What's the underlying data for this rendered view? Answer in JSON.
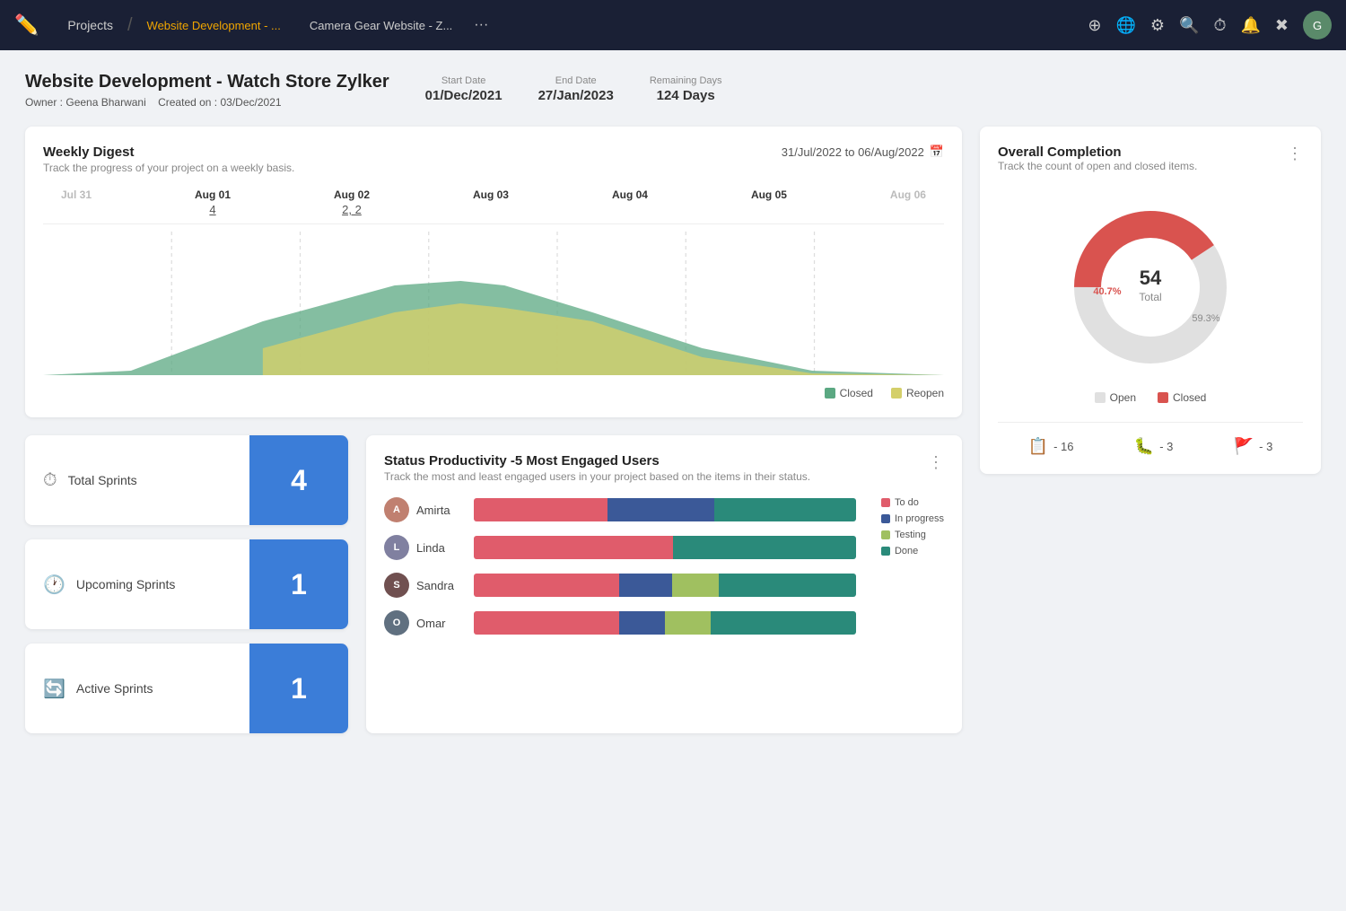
{
  "nav": {
    "logo": "✏",
    "projects_label": "Projects",
    "tab_active": "Website Development - ...",
    "tab_secondary": "Camera Gear Website - Z...",
    "dots": "···"
  },
  "project": {
    "title": "Website Development - Watch Store Zylker",
    "owner_label": "Owner :",
    "owner": "Geena Bharwani",
    "created_label": "Created on :",
    "created": "03/Dec/2021",
    "start_date_label": "Start Date",
    "start_date": "01/Dec/2021",
    "end_date_label": "End Date",
    "end_date": "27/Jan/2023",
    "remaining_label": "Remaining Days",
    "remaining": "124 Days"
  },
  "weekly_digest": {
    "title": "Weekly Digest",
    "subtitle": "Track the progress of your project on a weekly basis.",
    "date_range": "31/Jul/2022  to  06/Aug/2022",
    "columns": [
      {
        "label": "Jul 31",
        "value": "",
        "dimmed": true
      },
      {
        "label": "Aug 01",
        "value": "4",
        "dimmed": false
      },
      {
        "label": "Aug 02",
        "value": "2, 2",
        "dimmed": false
      },
      {
        "label": "Aug 03",
        "value": "",
        "dimmed": false
      },
      {
        "label": "Aug 04",
        "value": "",
        "dimmed": false
      },
      {
        "label": "Aug 05",
        "value": "",
        "dimmed": false
      },
      {
        "label": "Aug 06",
        "value": "",
        "dimmed": true
      }
    ],
    "legend": [
      {
        "label": "Closed",
        "color": "#5ba882"
      },
      {
        "label": "Reopen",
        "color": "#d4cf6a"
      }
    ]
  },
  "completion": {
    "title": "Overall Completion",
    "subtitle": "Track the count of open and closed items.",
    "total": "54",
    "total_label": "Total",
    "open_pct": "59.3%",
    "closed_pct": "40.7%",
    "open_color": "#e8e8e8",
    "closed_color": "#d9534f",
    "legend": [
      {
        "label": "Open",
        "color": "#e0e0e0"
      },
      {
        "label": "Closed",
        "color": "#d9534f"
      }
    ],
    "stats": [
      {
        "icon": "📋",
        "value": "16"
      },
      {
        "icon": "🐛",
        "value": "3"
      },
      {
        "icon": "🚩",
        "value": "3"
      }
    ]
  },
  "sprints": [
    {
      "label": "Total Sprints",
      "count": "4"
    },
    {
      "label": "Upcoming Sprints",
      "count": "1"
    },
    {
      "label": "Active Sprints",
      "count": "1"
    }
  ],
  "productivity": {
    "title": "Status Productivity -5 Most Engaged Users",
    "subtitle": "Track the most and least engaged users in your project based on the items in their status.",
    "legend": [
      {
        "label": "To do",
        "color": "#e05c6b"
      },
      {
        "label": "In progress",
        "color": "#3b5998"
      },
      {
        "label": "Testing",
        "color": "#a0c060"
      },
      {
        "label": "Done",
        "color": "#2a8a7a"
      }
    ],
    "users": [
      {
        "name": "Amirta",
        "avatar_bg": "#c08070",
        "segments": [
          {
            "color": "#e05c6b",
            "pct": 35
          },
          {
            "color": "#3b5998",
            "pct": 28
          },
          {
            "color": "#2a8a7a",
            "pct": 37
          }
        ]
      },
      {
        "name": "Linda",
        "avatar_bg": "#8080a0",
        "segments": [
          {
            "color": "#e05c6b",
            "pct": 52
          },
          {
            "color": "#2a8a7a",
            "pct": 48
          }
        ]
      },
      {
        "name": "Sandra",
        "avatar_bg": "#705050",
        "segments": [
          {
            "color": "#e05c6b",
            "pct": 38
          },
          {
            "color": "#3b5998",
            "pct": 14
          },
          {
            "color": "#a0c060",
            "pct": 12
          },
          {
            "color": "#2a8a7a",
            "pct": 36
          }
        ]
      },
      {
        "name": "Omar",
        "avatar_bg": "#607080",
        "segments": [
          {
            "color": "#e05c6b",
            "pct": 38
          },
          {
            "color": "#3b5998",
            "pct": 12
          },
          {
            "color": "#a0c060",
            "pct": 12
          },
          {
            "color": "#2a8a7a",
            "pct": 38
          }
        ]
      }
    ]
  }
}
